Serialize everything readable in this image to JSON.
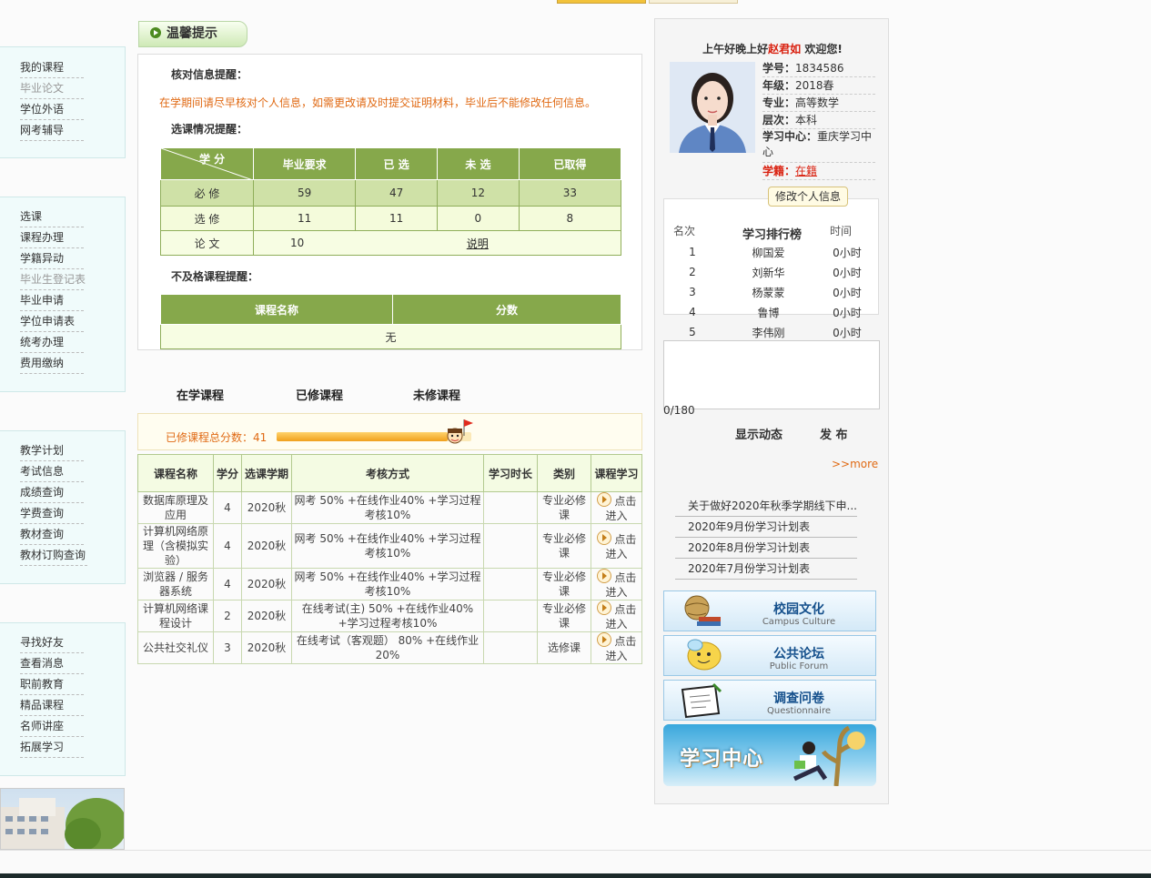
{
  "nav_groups": [
    {
      "items": [
        {
          "label": "我的课程"
        },
        {
          "label": "毕业论文",
          "gray": true
        },
        {
          "label": "学位外语"
        },
        {
          "label": "网考辅导"
        }
      ]
    },
    {
      "items": [
        {
          "label": "选课"
        },
        {
          "label": "课程办理"
        },
        {
          "label": "学籍异动"
        },
        {
          "label": "毕业生登记表",
          "gray": true
        },
        {
          "label": "毕业申请"
        },
        {
          "label": "学位申请表"
        },
        {
          "label": "统考办理"
        },
        {
          "label": "费用缴纳"
        }
      ]
    },
    {
      "items": [
        {
          "label": "教学计划"
        },
        {
          "label": "考试信息"
        },
        {
          "label": "成绩查询"
        },
        {
          "label": "学费查询"
        },
        {
          "label": "教材查询"
        },
        {
          "label": "教材订购查询"
        }
      ]
    },
    {
      "items": [
        {
          "label": "寻找好友"
        },
        {
          "label": "查看消息"
        },
        {
          "label": "职前教育"
        },
        {
          "label": "精品课程"
        },
        {
          "label": "名师讲座"
        },
        {
          "label": "拓展学习"
        }
      ]
    }
  ],
  "tip": {
    "tab_label": "温馨提示",
    "verify_title": "核对信息提醒：",
    "verify_text": "在学期间请尽早核对个人信息，如需更改请及时提交证明材料，毕业后不能修改任何信息。",
    "select_title": "选课情况提醒：",
    "select_table": {
      "corner_top": "学  分",
      "corner_bottom": "",
      "headers": [
        "毕业要求",
        "已 选",
        "未 选",
        "已取得"
      ],
      "rows": [
        {
          "label": "必 修",
          "cells": [
            "59",
            "47",
            "12",
            "33"
          ]
        },
        {
          "label": "选 修",
          "cells": [
            "11",
            "11",
            "0",
            "8"
          ]
        }
      ],
      "thesis_label": "论 文",
      "thesis_value": "10",
      "thesis_link": "说明"
    },
    "fail_title": "不及格课程提醒：",
    "fail_headers": [
      "课程名称",
      "分数"
    ],
    "fail_empty": "无"
  },
  "course_tabs": [
    "在学课程",
    "已修课程",
    "未修课程"
  ],
  "score_summary": {
    "label": "已修课程总分数：41",
    "progress_percent": 88
  },
  "course_table": {
    "headers": [
      "课程名称",
      "学分",
      "选课学期",
      "考核方式",
      "学习时长",
      "类别",
      "课程学习"
    ],
    "rows": [
      {
        "name": "数据库原理及应用",
        "credit": "4",
        "term": "2020秋",
        "exam": "网考 50% +在线作业40% +学习过程考核10%",
        "duration": "",
        "type": "专业必修课",
        "action": "点击进入"
      },
      {
        "name": "计算机网络原理（含模拟实验）",
        "credit": "4",
        "term": "2020秋",
        "exam": "网考 50% +在线作业40% +学习过程考核10%",
        "duration": "",
        "type": "专业必修课",
        "action": "点击进入"
      },
      {
        "name": "浏览器 / 服务器系统",
        "credit": "4",
        "term": "2020秋",
        "exam": "网考 50% +在线作业40% +学习过程考核10%",
        "duration": "",
        "type": "专业必修课",
        "action": "点击进入"
      },
      {
        "name": "计算机网络课程设计",
        "credit": "2",
        "term": "2020秋",
        "exam": "在线考试(主) 50% +在线作业40% +学习过程考核10%",
        "duration": "",
        "type": "专业必修课",
        "action": "点击进入"
      },
      {
        "name": "公共社交礼仪",
        "credit": "3",
        "term": "2020秋",
        "exam": "在线考试（客观题） 80% +在线作业20%",
        "duration": "",
        "type": "选修课",
        "action": "点击进入"
      }
    ]
  },
  "profile": {
    "greeting_prefix": "上午好晚上好",
    "name": "赵君如",
    "greeting_suffix": " 欢迎您!",
    "fields": [
      {
        "key": "学号：",
        "value": "1834586"
      },
      {
        "key": "年级：",
        "value": "2018春"
      },
      {
        "key": "专业：",
        "value": "高等数学"
      },
      {
        "key": "层次：",
        "value": "本科"
      },
      {
        "key": "学习中心：",
        "value": "重庆学习中心"
      }
    ],
    "status_key": "学籍：",
    "status_value": "在籍",
    "edit_button": "修改个人信息"
  },
  "ranking": {
    "title": "学习排行榜",
    "headers": [
      "名次",
      "时间"
    ],
    "rows": [
      {
        "rank": "1",
        "name": "柳国爱",
        "time": "0小时"
      },
      {
        "rank": "2",
        "name": "刘新华",
        "time": "0小时"
      },
      {
        "rank": "3",
        "name": "杨蒙蒙",
        "time": "0小时"
      },
      {
        "rank": "4",
        "name": "鲁博",
        "time": "0小时"
      },
      {
        "rank": "5",
        "name": "李伟刚",
        "time": "0小时"
      }
    ]
  },
  "post": {
    "counter": "0/180",
    "show_button": "显示动态",
    "publish_button": "发 布",
    "more": ">>more"
  },
  "news": [
    "关于做好2020年秋季学期线下申...",
    "2020年9月份学习计划表",
    "2020年8月份学习计划表",
    "2020年7月份学习计划表"
  ],
  "promos": [
    {
      "title": "校园文化",
      "subtitle": "Campus Culture",
      "icon": "globe-books-icon"
    },
    {
      "title": "公共论坛",
      "subtitle": "Public Forum",
      "icon": "speech-bubble-icon"
    },
    {
      "title": "调查问卷",
      "subtitle": "Questionnaire",
      "icon": "clipboard-icon"
    }
  ],
  "study_center_banner": "学习中心",
  "colors": {
    "green_header": "#86a84b",
    "orange_text": "#e06a14",
    "name_red": "#d9200f"
  }
}
